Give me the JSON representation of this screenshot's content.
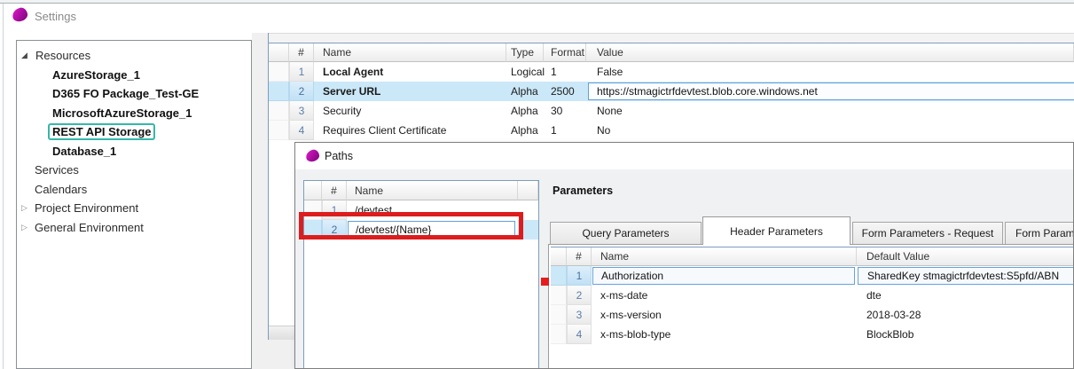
{
  "window": {
    "title": "Settings"
  },
  "colors": {
    "brand_magenta": "#a70d9d",
    "row_selection_blue": "#cbe8f8",
    "input_border_blue": "#62a1da",
    "tree_selected_border_teal": "#35b7aa",
    "annotation_red": "#dd1d1d",
    "grid_border_blue": "#7d9cbd"
  },
  "icons": {
    "app_icon": "magic-blob",
    "dialog_icon": "magic-blob",
    "tree_expanded_glyph": "◢",
    "tree_collapsed_glyph": "▷"
  },
  "sidebar": {
    "root_label": "Resources",
    "children": [
      {
        "label": "AzureStorage_1"
      },
      {
        "label": "D365 FO Package_Test-GE"
      },
      {
        "label": "MicrosoftAzureStorage_1"
      },
      {
        "label": "REST API Storage"
      },
      {
        "label": "Database_1"
      }
    ],
    "selected": "REST API Storage",
    "siblings": [
      {
        "label": "Services"
      },
      {
        "label": "Calendars"
      }
    ],
    "collapsed_nodes": [
      {
        "label": "Project Environment"
      },
      {
        "label": "General Environment"
      }
    ]
  },
  "settings_grid": {
    "headers": {
      "num": "#",
      "name": "Name",
      "type": "Type",
      "format": "Format",
      "value": "Value"
    },
    "rows": [
      {
        "num": "1",
        "name": "Local Agent",
        "type": "Logical",
        "format": "1",
        "value": "False"
      },
      {
        "num": "2",
        "name": "Server URL",
        "type": "Alpha",
        "format": "2500",
        "value": "https://stmagictrfdevtest.blob.core.windows.net"
      },
      {
        "num": "3",
        "name": "Security",
        "type": "Alpha",
        "format": "30",
        "value": "None"
      },
      {
        "num": "4",
        "name": "Requires Client Certificate",
        "type": "Alpha",
        "format": "1",
        "value": "No"
      }
    ]
  },
  "paths_dialog": {
    "title": "Paths",
    "paths_grid": {
      "headers": {
        "num": "#",
        "name": "Name"
      },
      "rows": [
        {
          "num": "1",
          "name": "/devtest"
        },
        {
          "num": "2",
          "name": "/devtest/{Name}"
        }
      ]
    },
    "parameters": {
      "section_label": "Parameters",
      "tabs": [
        {
          "label": "Query Parameters"
        },
        {
          "label": "Header Parameters"
        },
        {
          "label": "Form Parameters - Request"
        },
        {
          "label": "Form Paramet"
        }
      ],
      "active_tab": "Header Parameters",
      "grid": {
        "headers": {
          "num": "#",
          "name": "Name",
          "value": "Default Value"
        },
        "rows": [
          {
            "num": "1",
            "name": "Authorization",
            "value": "SharedKey stmagictrfdevtest:S5pfd/ABN"
          },
          {
            "num": "2",
            "name": "x-ms-date",
            "value": "dte"
          },
          {
            "num": "3",
            "name": "x-ms-version",
            "value": "2018-03-28"
          },
          {
            "num": "4",
            "name": "x-ms-blob-type",
            "value": "BlockBlob"
          }
        ]
      }
    }
  }
}
